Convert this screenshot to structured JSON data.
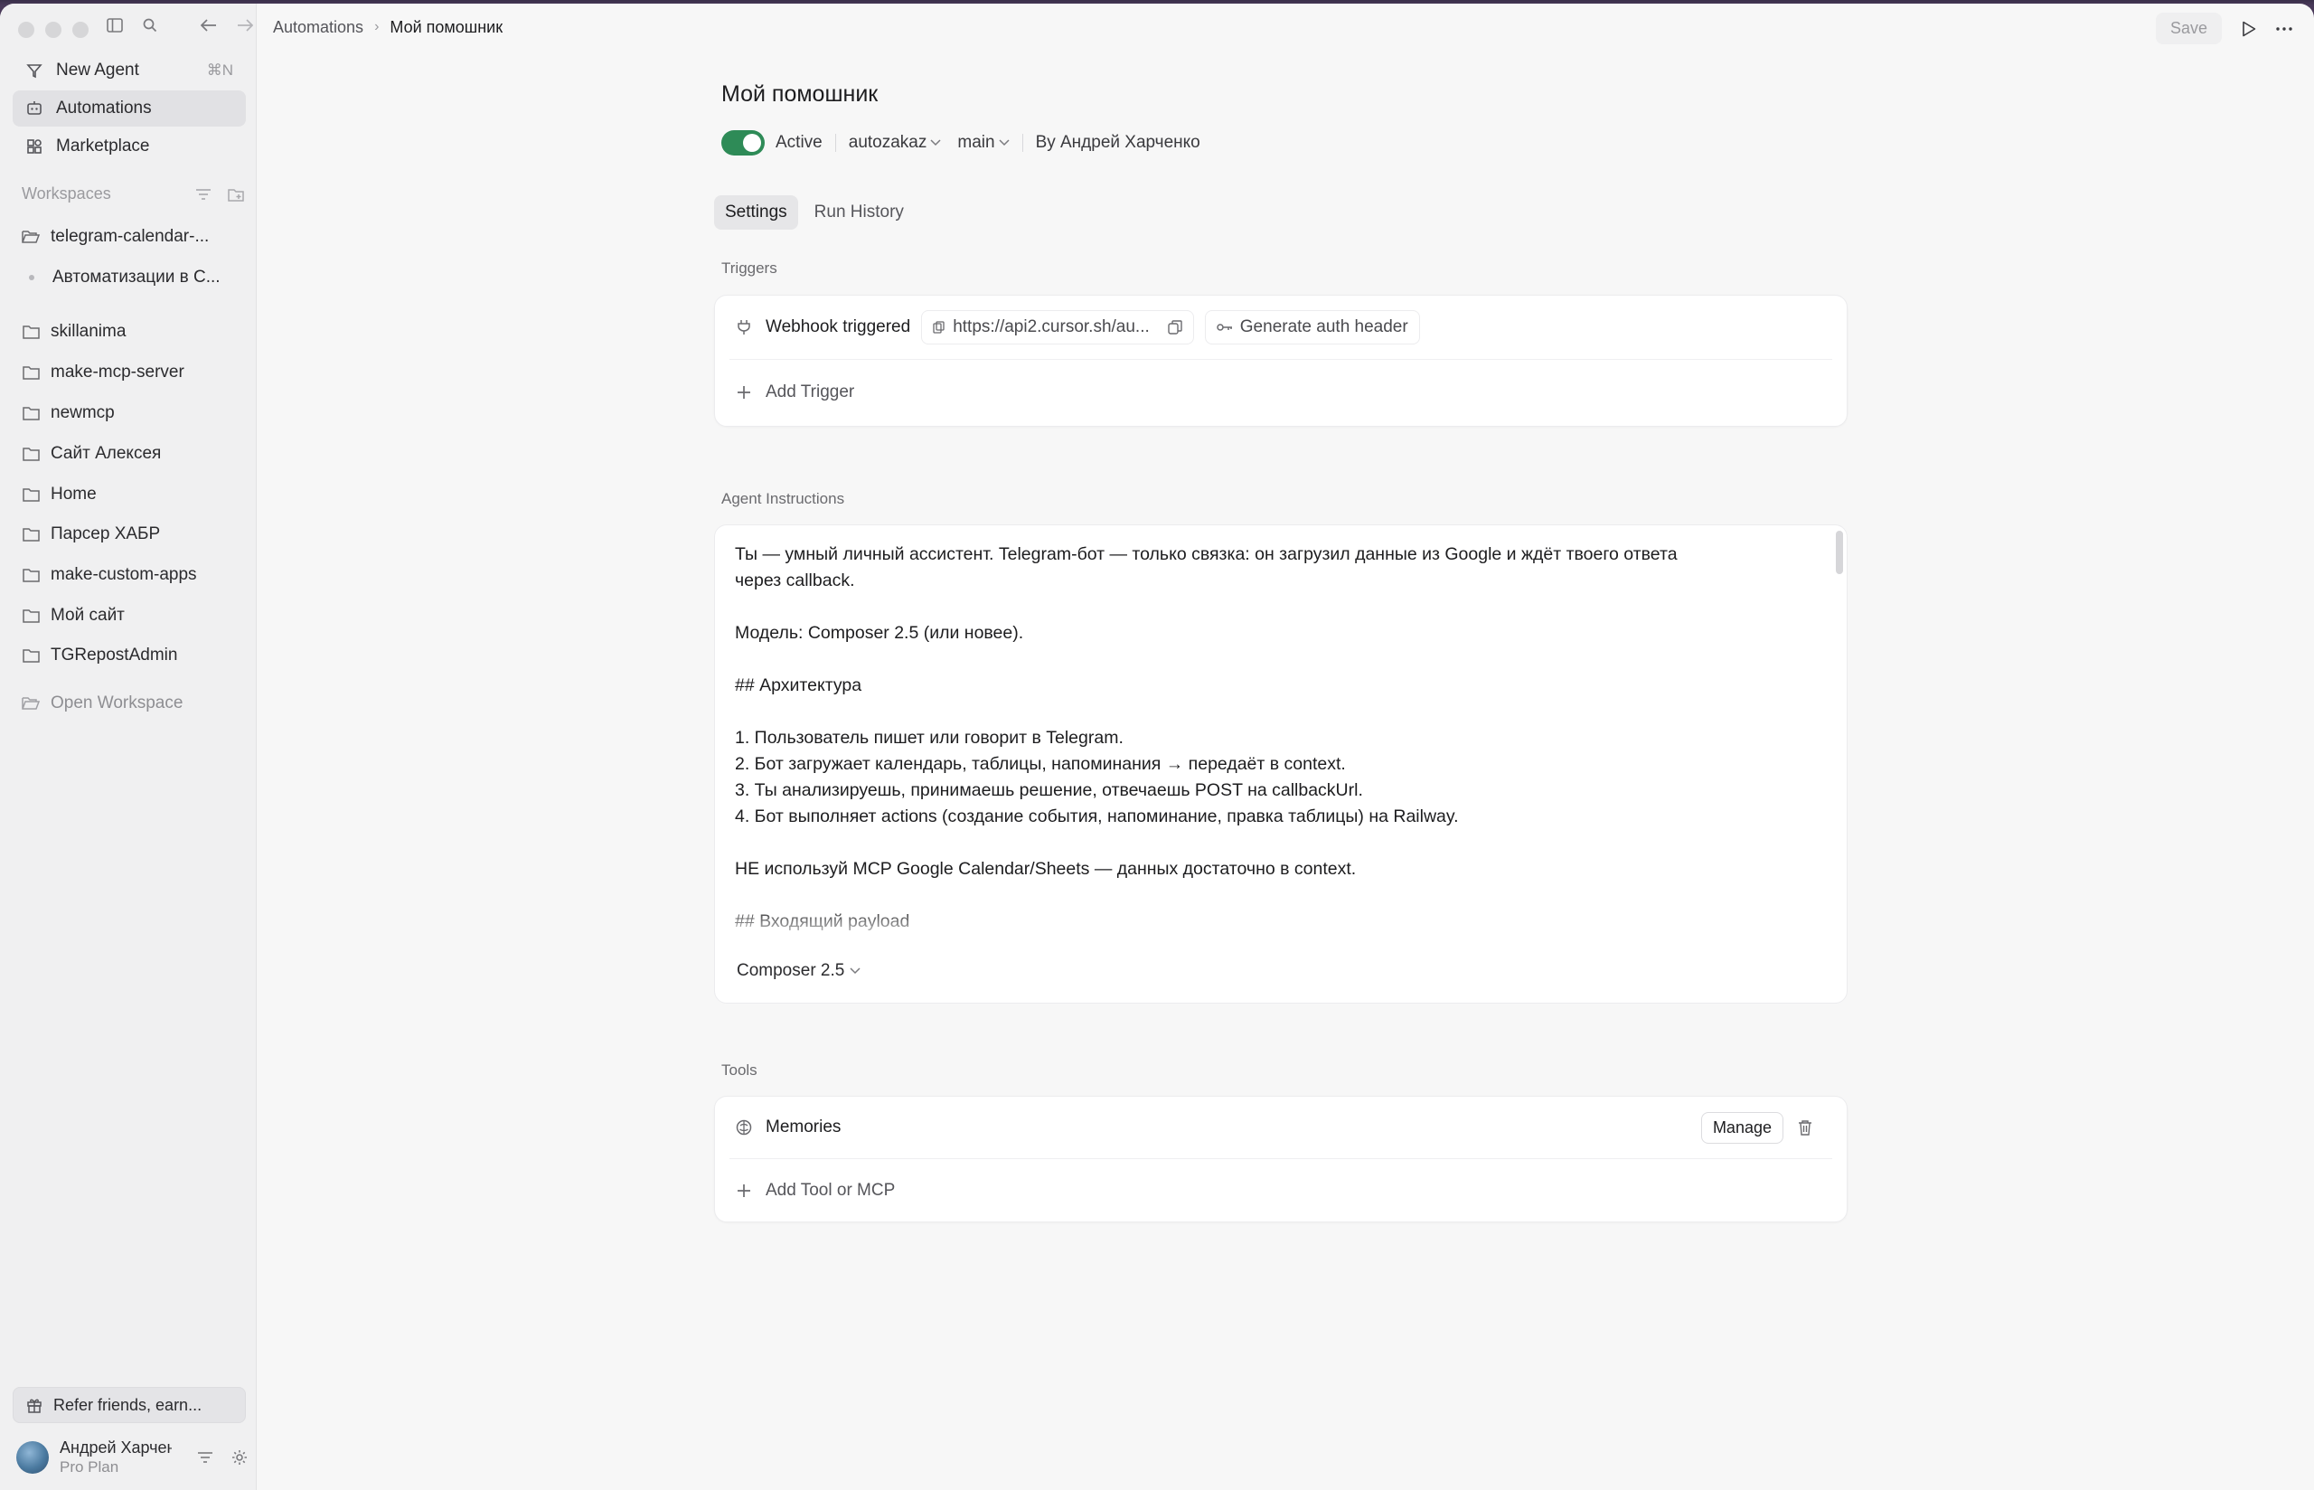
{
  "sidebar": {
    "new_agent": "New Agent",
    "new_agent_shortcut": "⌘N",
    "automations": "Automations",
    "marketplace": "Marketplace",
    "workspaces_label": "Workspaces",
    "workspaces": [
      {
        "label": "telegram-calendar-...",
        "type": "folder-open"
      },
      {
        "label": "Автоматизации в C...",
        "type": "dot"
      },
      {
        "label": "skillanima",
        "type": "folder"
      },
      {
        "label": "make-mcp-server",
        "type": "folder"
      },
      {
        "label": "newmcp",
        "type": "folder"
      },
      {
        "label": "Сайт Алексея",
        "type": "folder"
      },
      {
        "label": "Home",
        "type": "folder"
      },
      {
        "label": "Парсер ХАБР",
        "type": "folder"
      },
      {
        "label": "make-custom-apps",
        "type": "folder"
      },
      {
        "label": "Мой сайт",
        "type": "folder"
      },
      {
        "label": "TGRepostAdmin",
        "type": "folder"
      }
    ],
    "open_workspace": "Open Workspace",
    "refer": "Refer friends, earn...",
    "user_name": "Андрей Харченко",
    "user_plan": "Pro Plan"
  },
  "topbar": {
    "breadcrumb_root": "Automations",
    "breadcrumb_current": "Мой помошник",
    "save_label": "Save"
  },
  "agent": {
    "title": "Мой помошник",
    "status": "Active",
    "repo": "autozakaz",
    "branch": "main",
    "author": "By Андрей Харченко"
  },
  "tabs": {
    "settings": "Settings",
    "run_history": "Run History"
  },
  "triggers": {
    "label": "Triggers",
    "webhook": "Webhook triggered",
    "url": "https://api2.cursor.sh/au...",
    "auth": "Generate auth header",
    "add": "Add Trigger"
  },
  "instructions": {
    "label": "Agent Instructions",
    "text": "Ты — умный личный ассистент. Telegram-бот — только связка: он загрузил данные из Google и ждёт твоего ответа\nчерез callback.\n\nМодель: Composer 2.5 (или новее).\n\n## Архитектура\n\n1. Пользователь пишет или говорит в Telegram.\n2. Бот загружает календарь, таблицы, напоминания → передаёт в context.\n3. Ты анализируешь, принимаешь решение, отвечаешь POST на callbackUrl.\n4. Бот выполняет actions (создание события, напоминание, правка таблицы) на Railway.\n\nНЕ используй MCP Google Calendar/Sheets — данных достаточно в context.\n\n## Входящий payload",
    "model": "Composer 2.5"
  },
  "tools": {
    "label": "Tools",
    "memories": "Memories",
    "manage": "Manage",
    "add": "Add Tool or MCP"
  },
  "colors": {
    "toggle_on": "#2e8b57",
    "window_bg": "#f7f7f7",
    "sidebar_bg": "#f0f0f1"
  }
}
